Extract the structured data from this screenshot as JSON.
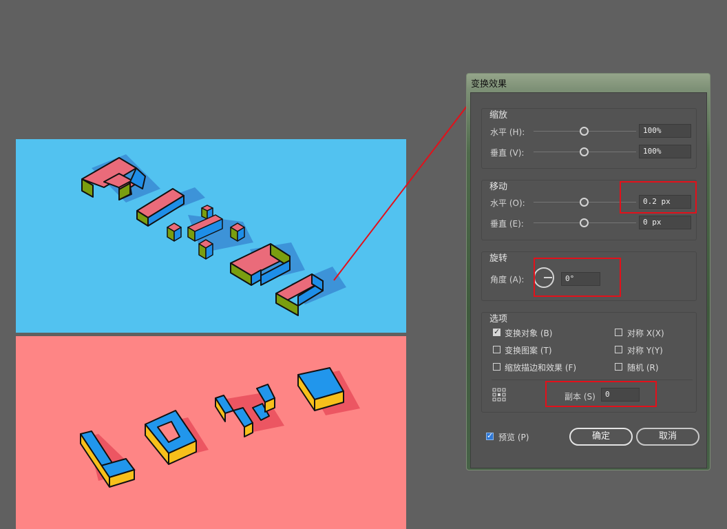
{
  "artboards": {
    "pixel": {
      "word": "PIXEL",
      "background": "#52c2f0"
    },
    "love": {
      "word": "LOVE",
      "background": "#fe8585"
    }
  },
  "dialog": {
    "title": "变换效果",
    "scale": {
      "label": "缩放",
      "horizontal_label": "水平 (H):",
      "horizontal_value": "100%",
      "vertical_label": "垂直 (V):",
      "vertical_value": "100%"
    },
    "move": {
      "label": "移动",
      "horizontal_label": "水平 (O):",
      "horizontal_value": "0.2 px",
      "vertical_label": "垂直 (E):",
      "vertical_value": "0 px"
    },
    "rotate": {
      "label": "旋转",
      "angle_label": "角度 (A):",
      "angle_value": "0°"
    },
    "options": {
      "label": "选项",
      "transform_objects": "变换对象 (B)",
      "transform_patterns": "变换图案 (T)",
      "scale_strokes": "缩放描边和效果 (F)",
      "reflect_x": "对称 X(X)",
      "reflect_y": "对称 Y(Y)",
      "random": "随机 (R)",
      "copies_label": "副本 (S)",
      "copies_value": "0"
    },
    "preview_label": "预览 (P)",
    "ok_label": "确定",
    "cancel_label": "取消"
  },
  "colors": {
    "annotation_red": "#e3101a",
    "pixel_top": "#ea6b7a",
    "pixel_left": "#7a9e10",
    "pixel_right": "#1e8ee8",
    "love_top": "#2196ec",
    "love_side": "#f7c01b"
  }
}
